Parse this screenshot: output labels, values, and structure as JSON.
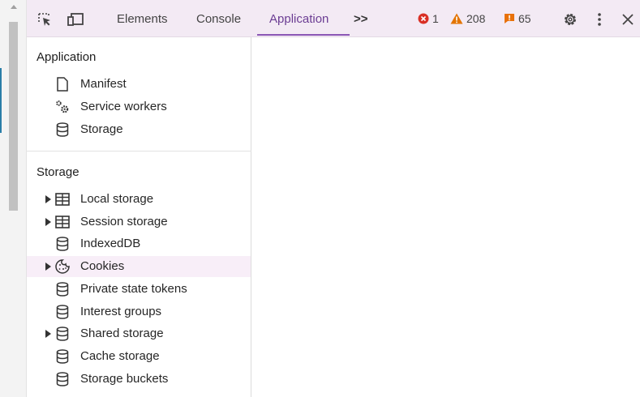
{
  "toolbar": {
    "tabs": [
      {
        "label": "Elements"
      },
      {
        "label": "Console"
      },
      {
        "label": "Application"
      }
    ],
    "more_tabs": ">>",
    "errors": "1",
    "warnings": "208",
    "issues": "65"
  },
  "sidebar": {
    "application_title": "Application",
    "application_items": [
      {
        "label": "Manifest",
        "icon": "document-icon"
      },
      {
        "label": "Service workers",
        "icon": "gears-icon"
      },
      {
        "label": "Storage",
        "icon": "database-icon"
      }
    ],
    "storage_title": "Storage",
    "storage_items": [
      {
        "label": "Local storage",
        "icon": "table-icon",
        "expandable": true
      },
      {
        "label": "Session storage",
        "icon": "table-icon",
        "expandable": true
      },
      {
        "label": "IndexedDB",
        "icon": "database-icon",
        "expandable": false
      },
      {
        "label": "Cookies",
        "icon": "cookie-icon",
        "expandable": true,
        "selected": true
      },
      {
        "label": "Private state tokens",
        "icon": "database-icon",
        "expandable": false
      },
      {
        "label": "Interest groups",
        "icon": "database-icon",
        "expandable": false
      },
      {
        "label": "Shared storage",
        "icon": "database-icon",
        "expandable": true
      },
      {
        "label": "Cache storage",
        "icon": "database-icon",
        "expandable": false
      },
      {
        "label": "Storage buckets",
        "icon": "database-icon",
        "expandable": false
      }
    ]
  },
  "colors": {
    "toolbar_bg": "#f3eaf4",
    "active_tab": "#6b3d93",
    "error": "#d93025",
    "warning": "#e37400",
    "issue": "#e8710a",
    "selected_row": "#f8eef8"
  }
}
